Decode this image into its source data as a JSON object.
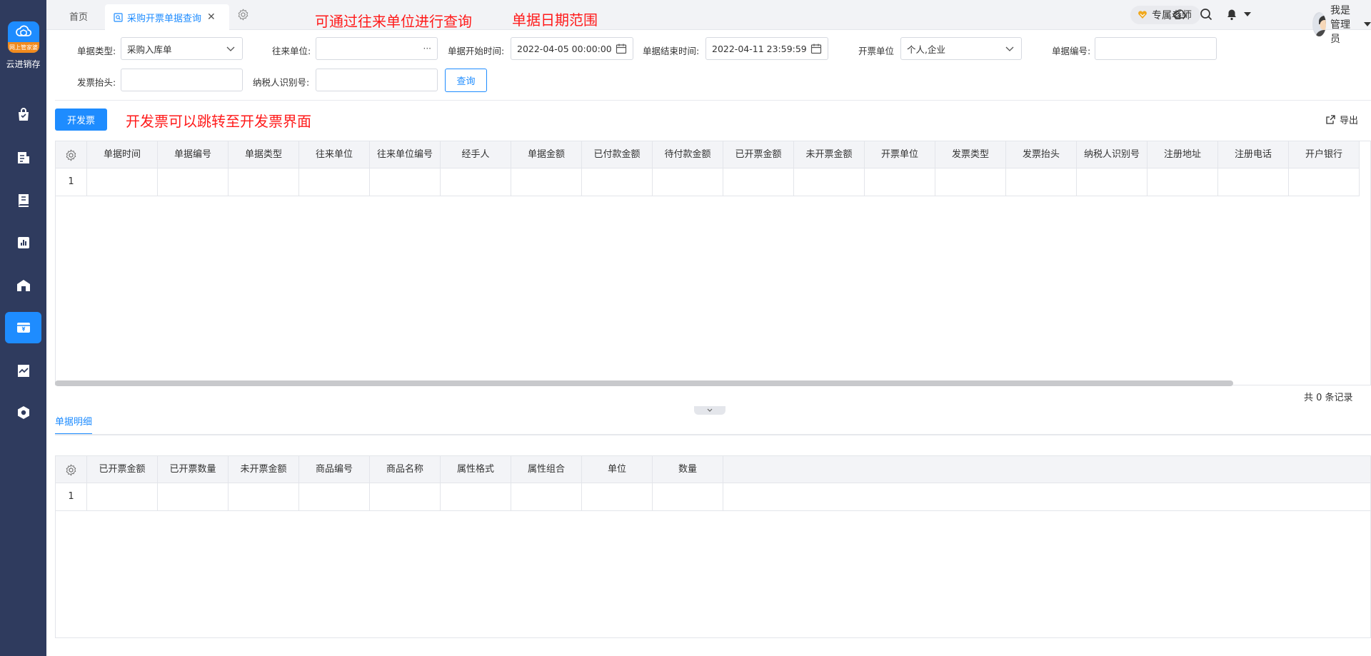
{
  "sidebar": {
    "logo_band": "网上管家婆",
    "logo_text": "云进销存",
    "nav": [
      {
        "icon": "shopping-bag-icon"
      },
      {
        "icon": "document-chart-icon"
      },
      {
        "icon": "ledger-icon"
      },
      {
        "icon": "bar-chart-icon"
      },
      {
        "icon": "warehouse-icon"
      },
      {
        "icon": "invoice-icon",
        "active": true
      },
      {
        "icon": "trend-report-icon"
      },
      {
        "icon": "settings-hexagon-icon"
      }
    ]
  },
  "tabs": {
    "home": "首页",
    "active": "采购开票单据查询",
    "close": "✕"
  },
  "annotations": {
    "unit_hint": "可通过往来单位进行查询",
    "date_hint": "单据日期范围",
    "invoice_hint": "开发票可以跳转至开发票界面"
  },
  "header": {
    "vip": "专属老师",
    "user": "我是管理员"
  },
  "filters": {
    "doc_type_label": "单据类型:",
    "doc_type_value": "采购入库单",
    "partner_label": "往来单位:",
    "partner_value": "",
    "partner_suffix": "···",
    "start_label": "单据开始时间:",
    "start_value": "2022-04-05 00:00:00",
    "end_label": "单据结束时间:",
    "end_value": "2022-04-11 23:59:59",
    "invoice_unit_label": "开票单位",
    "invoice_unit_value": "个人,企业",
    "doc_no_label": "单据编号:",
    "doc_no_value": "",
    "invoice_title_label": "发票抬头:",
    "invoice_title_value": "",
    "taxpayer_label": "纳税人识别号:",
    "taxpayer_value": "",
    "query_button": "查询"
  },
  "toolbar": {
    "invoice_button": "开发票",
    "export": "导出"
  },
  "main_table": {
    "columns": [
      "单据时间",
      "单据编号",
      "单据类型",
      "往来单位",
      "往来单位编号",
      "经手人",
      "单据金额",
      "已付款金额",
      "待付款金额",
      "已开票金额",
      "未开票金额",
      "开票单位",
      "发票类型",
      "发票抬头",
      "纳税人识别号",
      "注册地址",
      "注册电话",
      "开户银行"
    ],
    "rows": [
      {
        "index": "1"
      }
    ],
    "records": "共 0 条记录"
  },
  "detail": {
    "tab": "单据明细",
    "columns": [
      "已开票金额",
      "已开票数量",
      "未开票金额",
      "商品编号",
      "商品名称",
      "属性格式",
      "属性组合",
      "单位",
      "数量"
    ],
    "rows": [
      {
        "index": "1"
      }
    ]
  },
  "colors": {
    "sidebar": "#2f3b5e",
    "accent": "#1e8cff",
    "annotation": "#ff1a1a"
  }
}
